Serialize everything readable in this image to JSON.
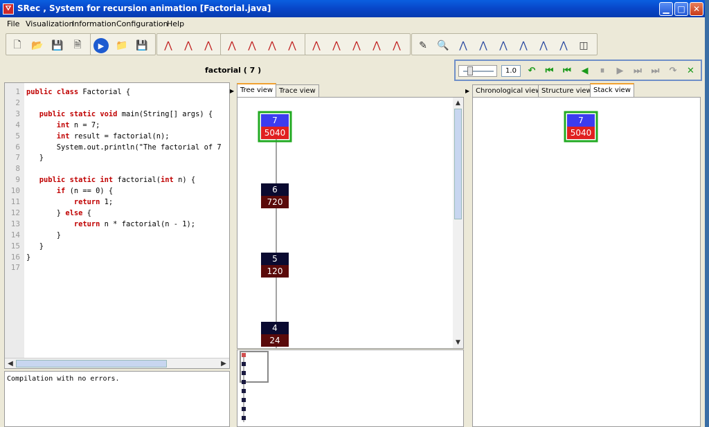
{
  "window": {
    "title": "SRec , System for recursion animation [Factorial.java]",
    "app_icon": "srec-app-icon"
  },
  "menu": [
    "File",
    "Visualization",
    "Information",
    "Configuration",
    "Help"
  ],
  "toolbar": {
    "groups": [
      [
        "new-file-icon",
        "open-folder-icon",
        "save-icon",
        "save-as-icon"
      ],
      [
        "run-icon",
        "open-class-icon",
        "save-class-icon"
      ],
      [
        "tree-expand-up-icon",
        "tree-expand-all-icon",
        "tree-collapse-icon"
      ],
      [
        "methods-filter-icon",
        "tree-layout-1-icon",
        "tree-layout-2-icon",
        "tree-layout-3-icon"
      ],
      [
        "tree-node-icon",
        "trace-icon",
        "stack-layout-icon",
        "table-layout-icon",
        "tree-spread-icon"
      ],
      [
        "color-palette-icon",
        "zoom-icon",
        "zoom-in-p1-icon",
        "zoom-out-p1-icon",
        "zoom-fit-p1-icon",
        "zoom-in-p2-icon",
        "zoom-out-p2-icon",
        "zoom-fit-p2-icon",
        "split-view-icon"
      ]
    ]
  },
  "controls": {
    "call_label": "factorial ( 7 )",
    "speed": "1.0",
    "buttons": [
      {
        "name": "undo-icon",
        "glyph": "↶",
        "color": "#1a9a1a"
      },
      {
        "name": "first-step-icon",
        "glyph": "⏮",
        "color": "#1a9a1a"
      },
      {
        "name": "back-step-icon",
        "glyph": "⏮",
        "color": "#1a9a1a"
      },
      {
        "name": "step-back-icon",
        "glyph": "◀",
        "color": "#1a9a1a"
      },
      {
        "name": "pause-icon",
        "glyph": "⏸",
        "color": "#9a9a9a"
      },
      {
        "name": "play-icon",
        "glyph": "▶",
        "color": "#9a9a9a"
      },
      {
        "name": "forward-step-icon",
        "glyph": "⏭",
        "color": "#9a9a9a"
      },
      {
        "name": "last-step-icon",
        "glyph": "⏭",
        "color": "#9a9a9a"
      },
      {
        "name": "redo-icon",
        "glyph": "↷",
        "color": "#9a9a9a"
      },
      {
        "name": "close-animation-icon",
        "glyph": "✕",
        "color": "#1a9a1a"
      }
    ]
  },
  "code": {
    "lines": [
      "public class Factorial {",
      "",
      "   public static void main(String[] args) {",
      "       int n = 7;",
      "       int result = factorial(n);",
      "       System.out.println(\"The factorial of 7",
      "   }",
      "",
      "   public static int factorial(int n) {",
      "       if (n == 0) {",
      "           return 1;",
      "       } else {",
      "           return n * factorial(n - 1);",
      "       }",
      "   }",
      "}",
      ""
    ]
  },
  "console": {
    "message": "Compilation with no errors."
  },
  "tree_tabs": [
    {
      "label": "Tree view",
      "active": true
    },
    {
      "label": "Trace view",
      "active": false
    }
  ],
  "right_tabs": [
    {
      "label": "Chronological view",
      "active": false
    },
    {
      "label": "Structure view",
      "active": false
    },
    {
      "label": "Stack view",
      "active": true
    }
  ],
  "tree_nodes": [
    {
      "param": "7",
      "result": "5040",
      "active": true
    },
    {
      "param": "6",
      "result": "720",
      "active": false
    },
    {
      "param": "5",
      "result": "120",
      "active": false
    },
    {
      "param": "4",
      "result": "24",
      "active": false
    }
  ],
  "stack_nodes": [
    {
      "param": "7",
      "result": "5040"
    }
  ],
  "colors": {
    "active_param": "#3c3cf0",
    "active_result": "#e02020",
    "active_border": "#22aa22",
    "done_param": "#0a0a30",
    "done_result": "#5a0a0a"
  }
}
